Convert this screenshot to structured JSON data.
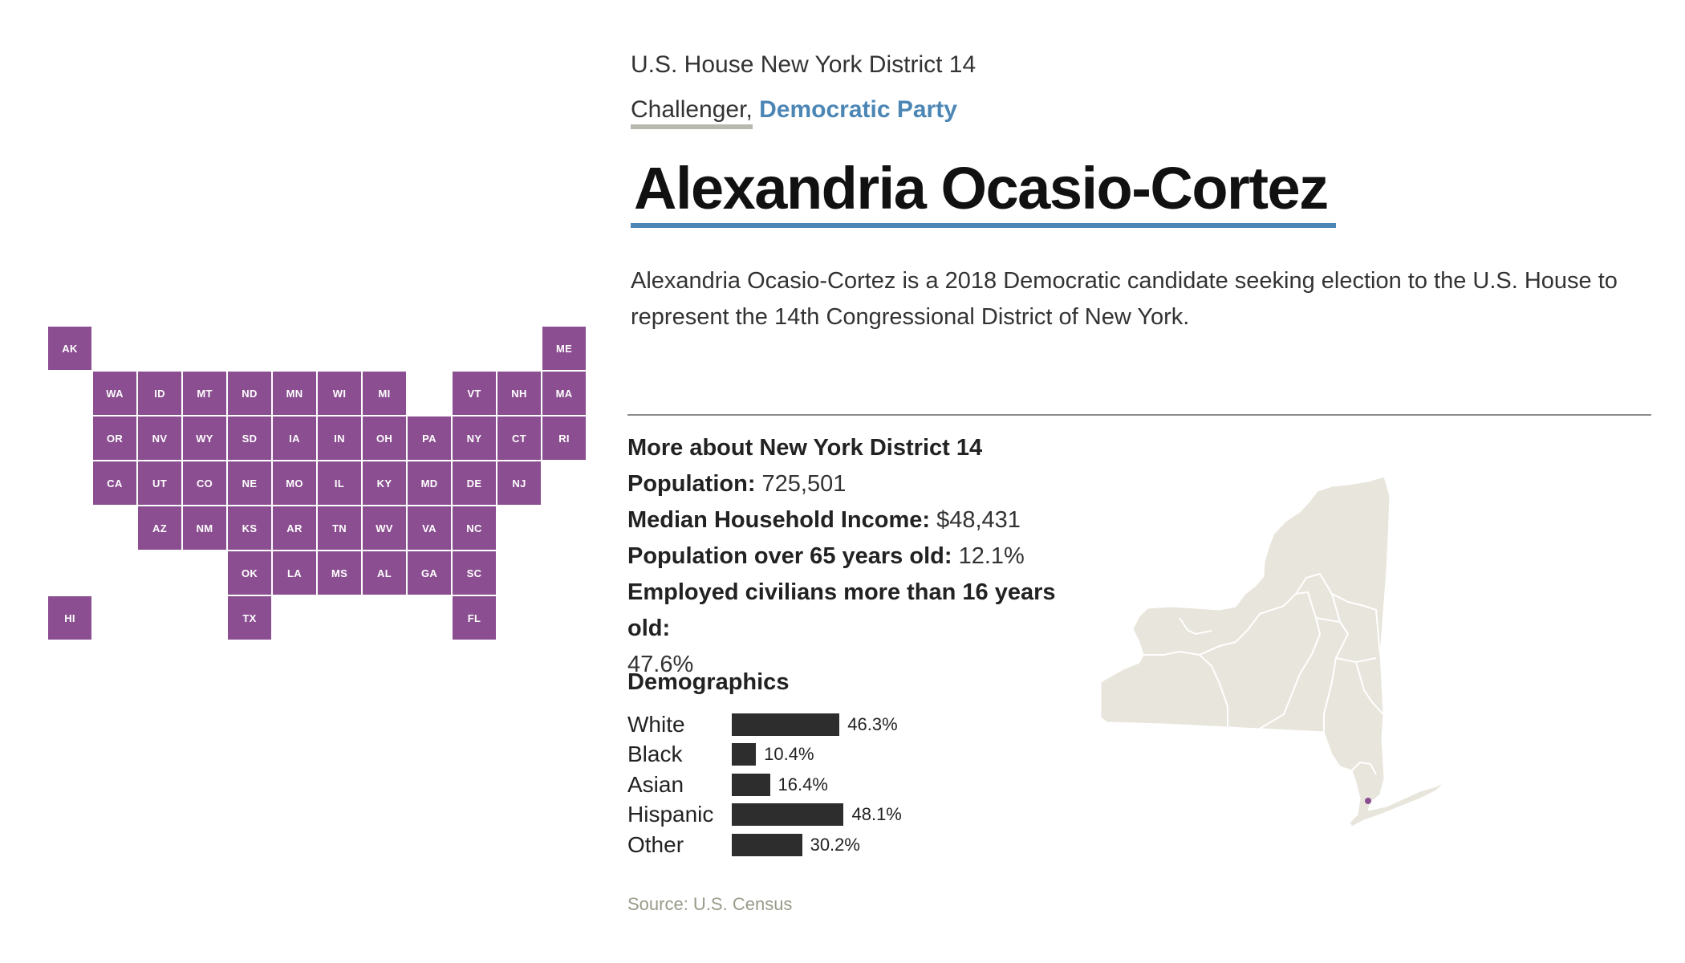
{
  "race": {
    "title": "U.S. House New York District 14",
    "role": "Challenger,",
    "party": "Democratic Party"
  },
  "candidate": {
    "name": "Alexandria Ocasio-Cortez",
    "bio": "Alexandria Ocasio-Cortez is a 2018 Democratic candidate seeking election to the U.S. House to represent the 14th Congressional District of New York."
  },
  "district_info": {
    "heading": "More about New York District 14",
    "population_label": "Population:",
    "population_value": "725,501",
    "income_label": "Median Household Income:",
    "income_value": "$48,431",
    "over65_label": "Population over 65 years old:",
    "over65_value": "12.1%",
    "employed_label": "Employed civilians more than 16 years old:",
    "employed_value": "47.6%"
  },
  "demographics": {
    "heading": "Demographics",
    "rows": [
      {
        "label": "White",
        "value": "46.3%",
        "pct": 46.3
      },
      {
        "label": "Black",
        "value": "10.4%",
        "pct": 10.4
      },
      {
        "label": "Asian",
        "value": "16.4%",
        "pct": 16.4
      },
      {
        "label": "Hispanic",
        "value": "48.1%",
        "pct": 48.1
      },
      {
        "label": "Other",
        "value": "30.2%",
        "pct": 30.2
      }
    ]
  },
  "source": "Source: U.S. Census",
  "tile_map": {
    "color": "#8b4f91",
    "states": [
      {
        "abbr": "AK",
        "col": 0,
        "row": 0
      },
      {
        "abbr": "ME",
        "col": 11,
        "row": 0
      },
      {
        "abbr": "WA",
        "col": 1,
        "row": 1
      },
      {
        "abbr": "ID",
        "col": 2,
        "row": 1
      },
      {
        "abbr": "MT",
        "col": 3,
        "row": 1
      },
      {
        "abbr": "ND",
        "col": 4,
        "row": 1
      },
      {
        "abbr": "MN",
        "col": 5,
        "row": 1
      },
      {
        "abbr": "WI",
        "col": 6,
        "row": 1
      },
      {
        "abbr": "MI",
        "col": 7,
        "row": 1
      },
      {
        "abbr": "VT",
        "col": 9,
        "row": 1
      },
      {
        "abbr": "NH",
        "col": 10,
        "row": 1
      },
      {
        "abbr": "MA",
        "col": 11,
        "row": 1
      },
      {
        "abbr": "OR",
        "col": 1,
        "row": 2
      },
      {
        "abbr": "NV",
        "col": 2,
        "row": 2
      },
      {
        "abbr": "WY",
        "col": 3,
        "row": 2
      },
      {
        "abbr": "SD",
        "col": 4,
        "row": 2
      },
      {
        "abbr": "IA",
        "col": 5,
        "row": 2
      },
      {
        "abbr": "IN",
        "col": 6,
        "row": 2
      },
      {
        "abbr": "OH",
        "col": 7,
        "row": 2
      },
      {
        "abbr": "PA",
        "col": 8,
        "row": 2
      },
      {
        "abbr": "NY",
        "col": 9,
        "row": 2
      },
      {
        "abbr": "CT",
        "col": 10,
        "row": 2
      },
      {
        "abbr": "RI",
        "col": 11,
        "row": 2
      },
      {
        "abbr": "CA",
        "col": 1,
        "row": 3
      },
      {
        "abbr": "UT",
        "col": 2,
        "row": 3
      },
      {
        "abbr": "CO",
        "col": 3,
        "row": 3
      },
      {
        "abbr": "NE",
        "col": 4,
        "row": 3
      },
      {
        "abbr": "MO",
        "col": 5,
        "row": 3
      },
      {
        "abbr": "IL",
        "col": 6,
        "row": 3
      },
      {
        "abbr": "KY",
        "col": 7,
        "row": 3
      },
      {
        "abbr": "MD",
        "col": 8,
        "row": 3
      },
      {
        "abbr": "DE",
        "col": 9,
        "row": 3
      },
      {
        "abbr": "NJ",
        "col": 10,
        "row": 3
      },
      {
        "abbr": "AZ",
        "col": 2,
        "row": 4
      },
      {
        "abbr": "NM",
        "col": 3,
        "row": 4
      },
      {
        "abbr": "KS",
        "col": 4,
        "row": 4
      },
      {
        "abbr": "AR",
        "col": 5,
        "row": 4
      },
      {
        "abbr": "TN",
        "col": 6,
        "row": 4
      },
      {
        "abbr": "WV",
        "col": 7,
        "row": 4
      },
      {
        "abbr": "VA",
        "col": 8,
        "row": 4
      },
      {
        "abbr": "NC",
        "col": 9,
        "row": 4
      },
      {
        "abbr": "OK",
        "col": 4,
        "row": 5
      },
      {
        "abbr": "LA",
        "col": 5,
        "row": 5
      },
      {
        "abbr": "MS",
        "col": 6,
        "row": 5
      },
      {
        "abbr": "AL",
        "col": 7,
        "row": 5
      },
      {
        "abbr": "GA",
        "col": 8,
        "row": 5
      },
      {
        "abbr": "SC",
        "col": 9,
        "row": 5
      },
      {
        "abbr": "HI",
        "col": 0,
        "row": 6
      },
      {
        "abbr": "TX",
        "col": 4,
        "row": 6
      },
      {
        "abbr": "FL",
        "col": 9,
        "row": 6
      }
    ]
  },
  "ny_map": {
    "fill": "#e8e5dc",
    "highlight": "#8b4f91"
  }
}
